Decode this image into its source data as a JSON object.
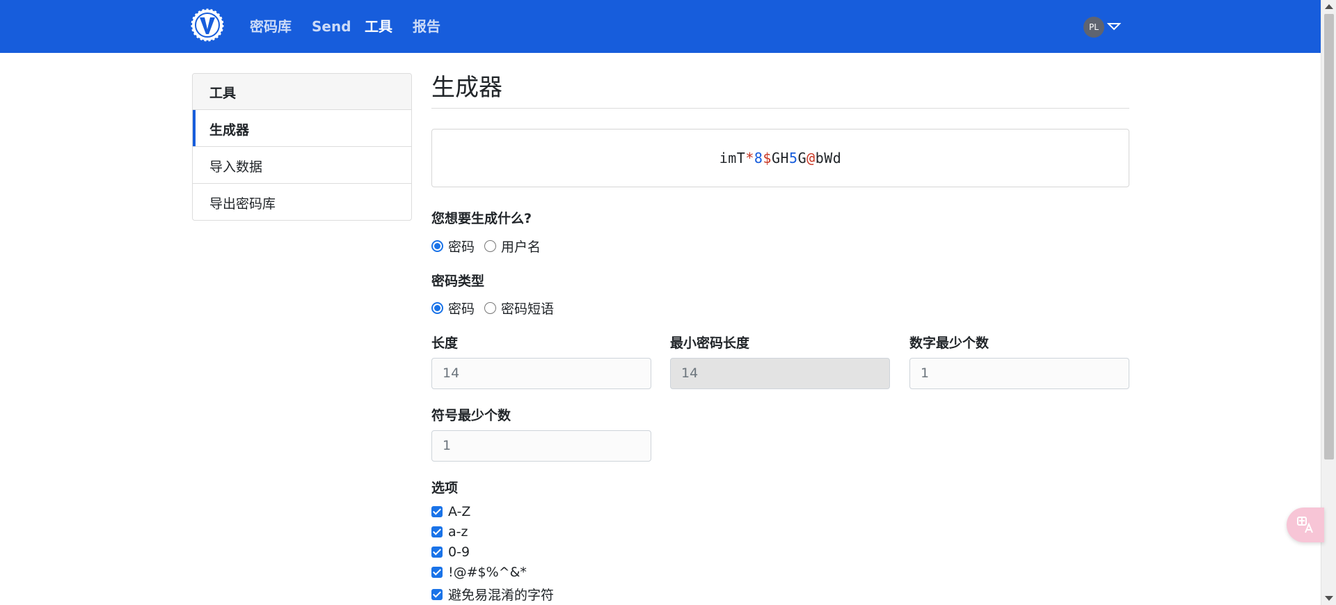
{
  "nav": {
    "items": [
      {
        "label": "密码库"
      },
      {
        "label": "Send"
      },
      {
        "label": "工具"
      },
      {
        "label": "报告"
      }
    ],
    "avatar_initials": "PL"
  },
  "sidebar": {
    "heading": "工具",
    "items": [
      {
        "label": "生成器"
      },
      {
        "label": "导入数据"
      },
      {
        "label": "导出密码库"
      }
    ]
  },
  "main": {
    "title": "生成器",
    "generated_password": [
      {
        "t": "imT",
        "k": "c"
      },
      {
        "t": "*",
        "k": "s"
      },
      {
        "t": "8",
        "k": "n"
      },
      {
        "t": "$",
        "k": "s"
      },
      {
        "t": "GH",
        "k": "c"
      },
      {
        "t": "5",
        "k": "n"
      },
      {
        "t": "G",
        "k": "c"
      },
      {
        "t": "@",
        "k": "s"
      },
      {
        "t": "bWd",
        "k": "c"
      }
    ],
    "what_to_generate": {
      "label": "您想要生成什么?",
      "options": [
        {
          "label": "密码",
          "selected": true
        },
        {
          "label": "用户名",
          "selected": false
        }
      ]
    },
    "password_type": {
      "label": "密码类型",
      "options": [
        {
          "label": "密码",
          "selected": true
        },
        {
          "label": "密码短语",
          "selected": false
        }
      ]
    },
    "fields": {
      "length": {
        "label": "长度",
        "value": "14"
      },
      "min_length": {
        "label": "最小密码长度",
        "value": "14"
      },
      "min_numbers": {
        "label": "数字最少个数",
        "value": "1"
      },
      "min_special": {
        "label": "符号最少个数",
        "value": "1"
      }
    },
    "options": {
      "label": "选项",
      "items": [
        {
          "label": "A-Z",
          "checked": true
        },
        {
          "label": "a-z",
          "checked": true
        },
        {
          "label": "0-9",
          "checked": true
        },
        {
          "label": "!@#$%^&*",
          "checked": true
        },
        {
          "label": "避免易混淆的字符",
          "checked": true
        }
      ]
    }
  },
  "colors": {
    "brand": "#175ddc",
    "number": "#175ddc",
    "special": "#c83522"
  }
}
